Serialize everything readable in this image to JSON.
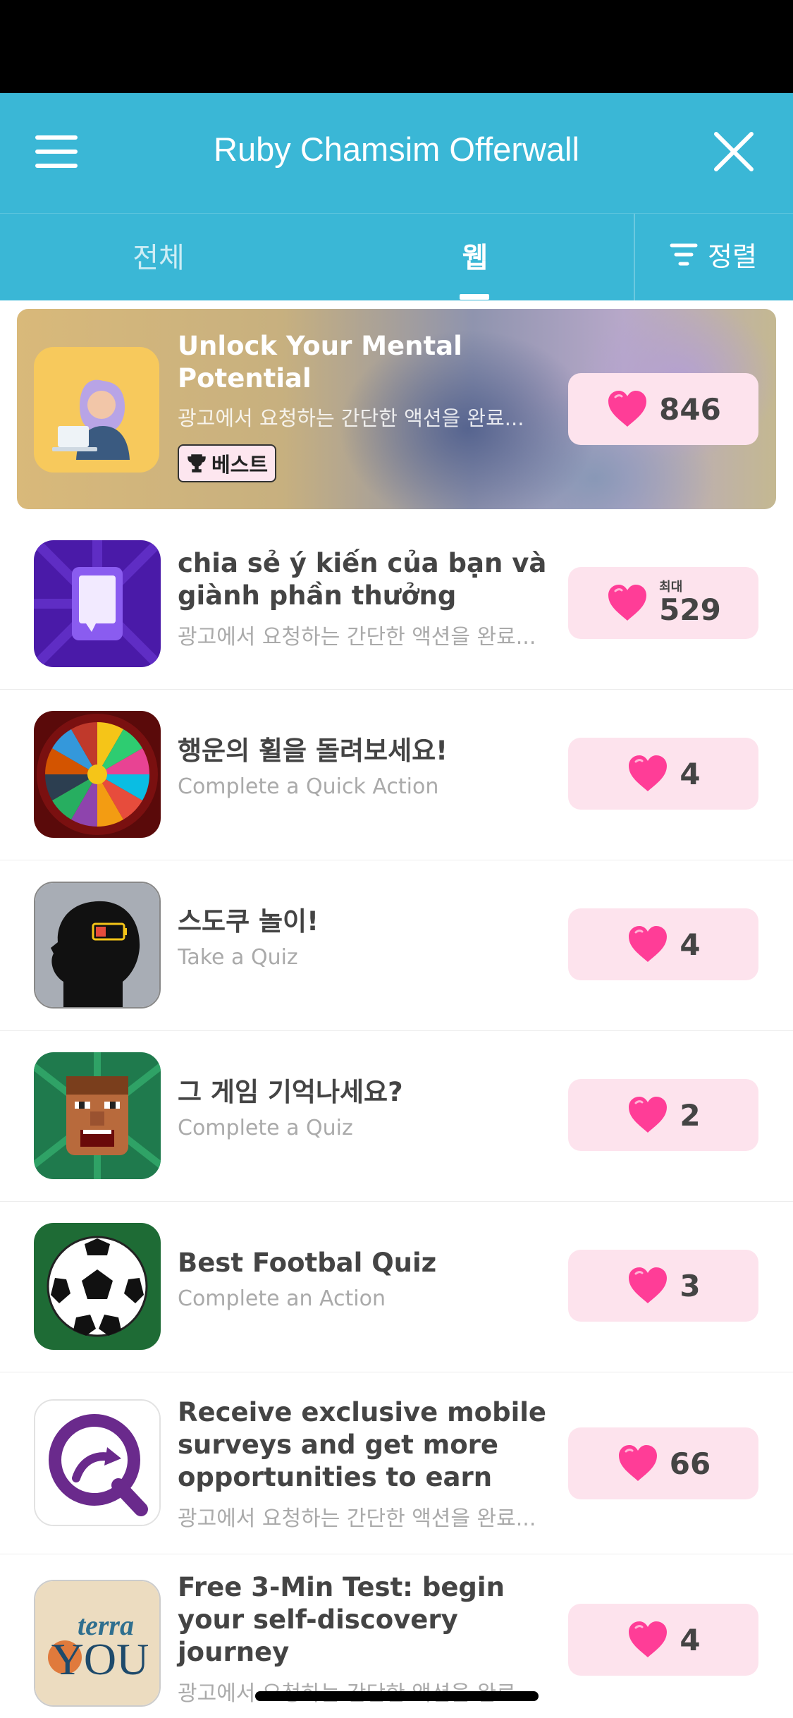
{
  "header": {
    "title": "Ruby Chamsim Offerwall"
  },
  "tabs": [
    {
      "label": "전체"
    },
    {
      "label": "웹"
    }
  ],
  "sort_label": "정렬",
  "featured": {
    "title": "Unlock Your Mental Potential",
    "subtitle": "광고에서 요청하는 간단한 액션을 완료...",
    "badge": "베스트",
    "points": "846"
  },
  "offers": [
    {
      "title": "chia sẻ ý kiến của bạn và giành phần thưởng",
      "subtitle": "광고에서 요청하는 간단한 액션을 완료...",
      "max_label": "최대",
      "points": "529"
    },
    {
      "title": "행운의 휠을 돌려보세요!",
      "subtitle": "Complete a Quick Action",
      "points": "4"
    },
    {
      "title": "스도쿠 놀이!",
      "subtitle": "Take a Quiz",
      "points": "4"
    },
    {
      "title": "그 게임 기억나세요?",
      "subtitle": "Complete a Quiz",
      "points": "2"
    },
    {
      "title": "Best Footbal Quiz",
      "subtitle": "Complete an Action",
      "points": "3"
    },
    {
      "title": "Receive exclusive mobile surveys and get more opportunities to earn",
      "subtitle": "광고에서 요청하는 간단한 액션을 완료...",
      "points": "66"
    },
    {
      "title": "Free 3-Min Test: begin your self-discovery journey",
      "subtitle": "광고에서 요청하는 간단한 액션을 완료...",
      "points": "4",
      "icon_text_1": "terra",
      "icon_text_2": "YOU"
    }
  ],
  "colors": {
    "appbar": "#3ab7d6",
    "heart": "#ff3d97",
    "reward_bg": "#fde3ed"
  }
}
